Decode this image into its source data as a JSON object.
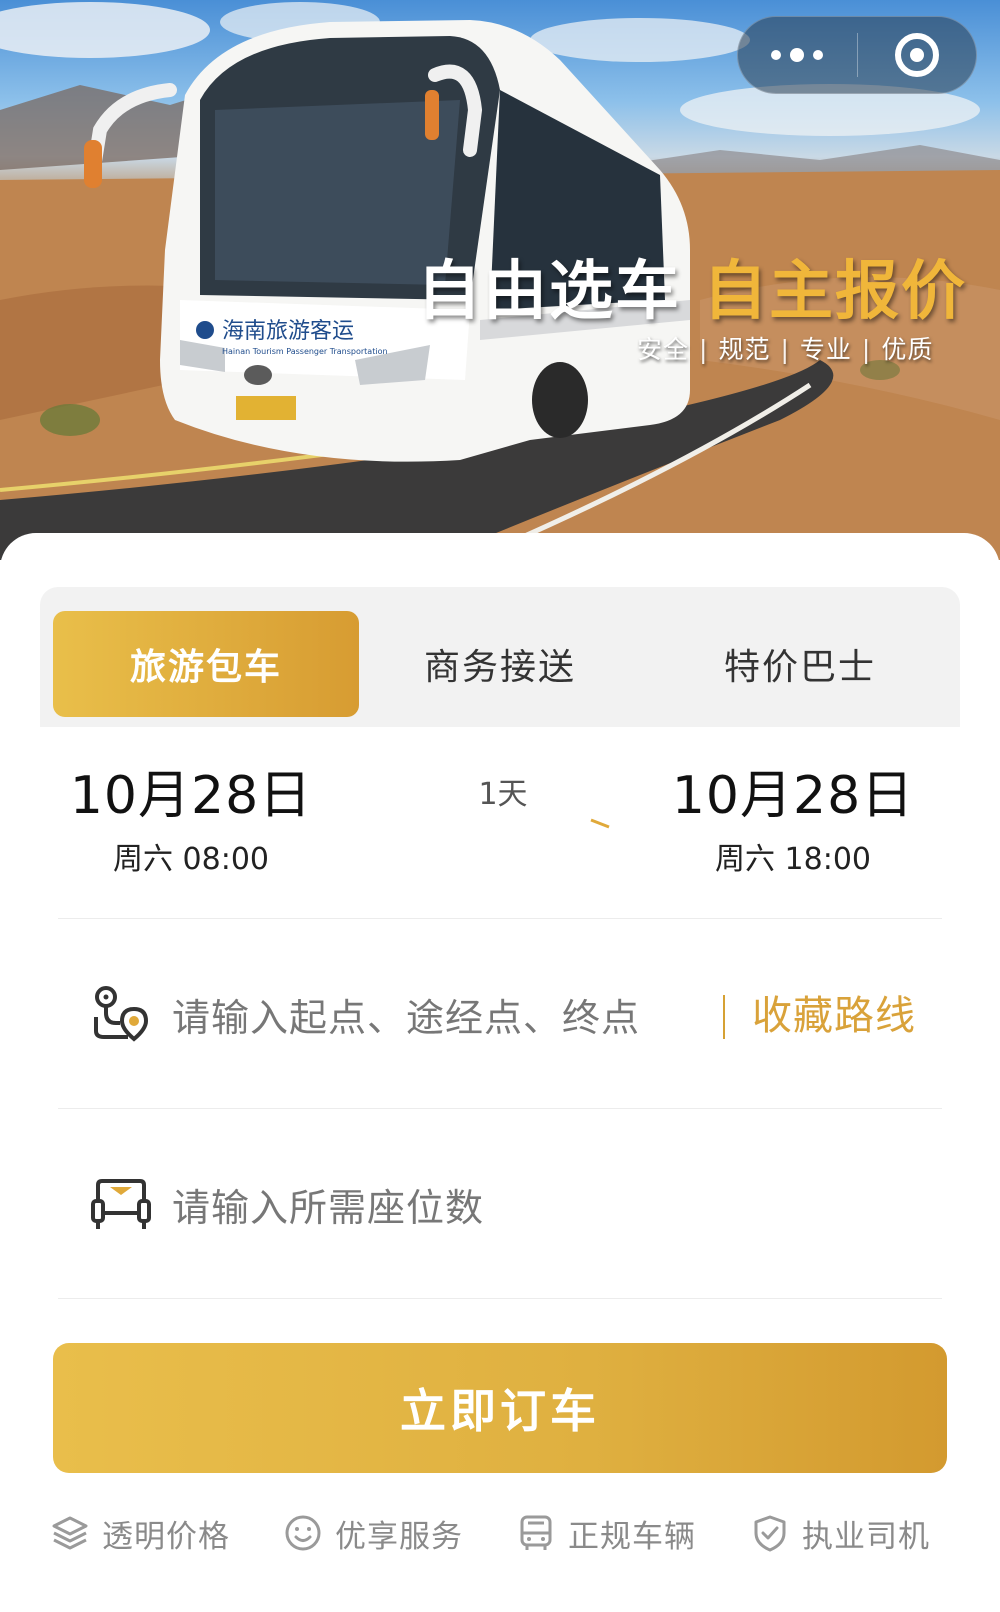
{
  "hero": {
    "bus_logo_text": "海南旅游客运",
    "bus_logo_sub": "Hainan Tourism Passenger Transportation",
    "slogan_white": "自由选车",
    "slogan_gold": "自主报价",
    "tags": [
      "安全",
      "规范",
      "专业",
      "优质"
    ],
    "separator": "|"
  },
  "tabs": [
    {
      "label": "旅游包车",
      "active": true
    },
    {
      "label": "商务接送",
      "active": false
    },
    {
      "label": "特价巴士",
      "active": false
    }
  ],
  "trip": {
    "start": {
      "date": "10月28日",
      "weekday_time": "周六 08:00"
    },
    "duration": "1天",
    "end": {
      "date": "10月28日",
      "weekday_time": "周六 18:00"
    }
  },
  "route": {
    "placeholder": "请输入起点、途经点、终点",
    "favorite_label": "收藏路线"
  },
  "seats": {
    "placeholder": "请输入所需座位数"
  },
  "order_button": "立即订车",
  "features": [
    {
      "label": "透明价格",
      "icon": "layers-icon"
    },
    {
      "label": "优享服务",
      "icon": "smile-icon"
    },
    {
      "label": "正规车辆",
      "icon": "bus-icon"
    },
    {
      "label": "执业司机",
      "icon": "shield-check-icon"
    }
  ],
  "colors": {
    "accent_gold": "#D9A23A",
    "button_gradient_start": "#E9BE4B",
    "button_gradient_end": "#D39A2F"
  }
}
